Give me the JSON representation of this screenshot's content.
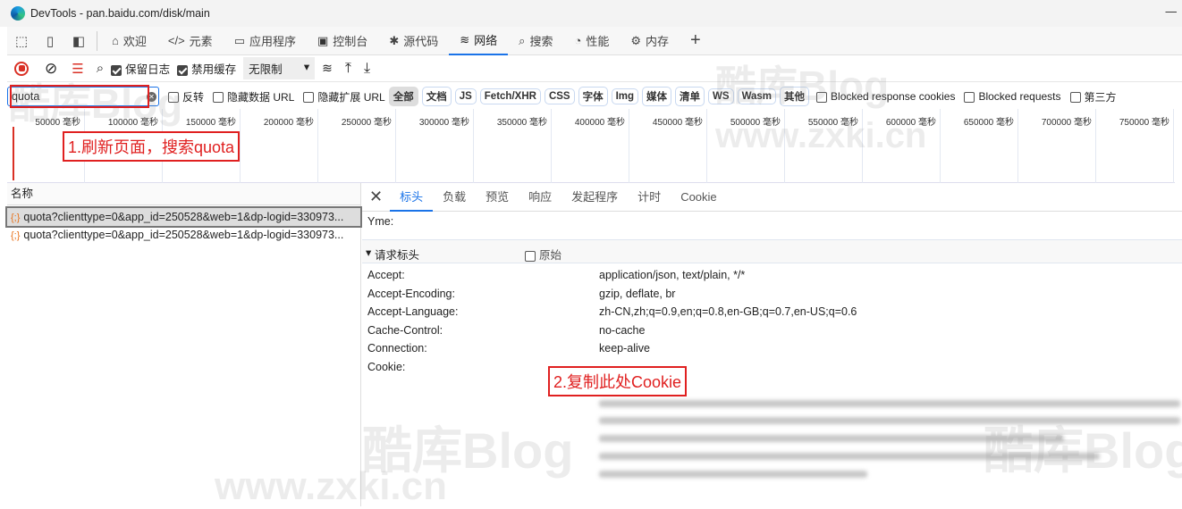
{
  "window": {
    "title": "DevTools - pan.baidu.com/disk/main",
    "minimize": "—"
  },
  "tabs": [
    {
      "label": "欢迎",
      "icon": "home-icon"
    },
    {
      "label": "元素",
      "icon": "code-icon"
    },
    {
      "label": "应用程序",
      "icon": "app-icon"
    },
    {
      "label": "控制台",
      "icon": "console-icon"
    },
    {
      "label": "源代码",
      "icon": "bug-icon"
    },
    {
      "label": "网络",
      "icon": "wifi-icon",
      "active": true
    },
    {
      "label": "搜索",
      "icon": "search-icon"
    },
    {
      "label": "性能",
      "icon": "gauge-icon"
    },
    {
      "label": "内存",
      "icon": "chip-icon"
    }
  ],
  "add_tab": "+",
  "toolbar": {
    "preserve_log": "保留日志",
    "disable_cache": "禁用缓存",
    "throttle": "无限制"
  },
  "filter": {
    "value": "quota",
    "invert": "反转",
    "hide_data_url": "隐藏数据 URL",
    "hide_ext_url": "隐藏扩展 URL",
    "types": [
      "全部",
      "文档",
      "JS",
      "Fetch/XHR",
      "CSS",
      "字体",
      "Img",
      "媒体",
      "清单",
      "WS",
      "Wasm",
      "其他"
    ],
    "blocked_cookies": "Blocked response cookies",
    "blocked_requests": "Blocked requests",
    "third_party": "第三方"
  },
  "timeline": {
    "ticks": [
      "50000 毫秒",
      "100000 毫秒",
      "150000 毫秒",
      "200000 毫秒",
      "250000 毫秒",
      "300000 毫秒",
      "350000 毫秒",
      "400000 毫秒",
      "450000 毫秒",
      "500000 毫秒",
      "550000 毫秒",
      "600000 毫秒",
      "650000 毫秒",
      "700000 毫秒",
      "750000 毫秒"
    ]
  },
  "list": {
    "header": "名称",
    "rows": [
      "quota?clienttype=0&app_id=250528&web=1&dp-logid=330973...",
      "quota?clienttype=0&app_id=250528&web=1&dp-logid=330973..."
    ]
  },
  "detail": {
    "tabs": [
      "标头",
      "负载",
      "预览",
      "响应",
      "发起程序",
      "计时",
      "Cookie"
    ],
    "prev_row": "Yme:",
    "section": "请求标头",
    "raw": "原始",
    "headers": [
      {
        "k": "Accept:",
        "v": "application/json, text/plain, */*"
      },
      {
        "k": "Accept-Encoding:",
        "v": "gzip, deflate, br"
      },
      {
        "k": "Accept-Language:",
        "v": "zh-CN,zh;q=0.9,en;q=0.8,en-GB;q=0.7,en-US;q=0.6"
      },
      {
        "k": "Cache-Control:",
        "v": "no-cache"
      },
      {
        "k": "Connection:",
        "v": "keep-alive"
      },
      {
        "k": "Cookie:",
        "v": ""
      }
    ]
  },
  "annotations": {
    "step1": "1.刷新页面，搜索quota",
    "step2": "2.复制此处Cookie"
  },
  "watermark": {
    "text": "酷库Blog",
    "url": "www.zxki.cn"
  },
  "colors": {
    "accent": "#1a73e8",
    "annotation": "#e02020",
    "record": "#d93025"
  }
}
